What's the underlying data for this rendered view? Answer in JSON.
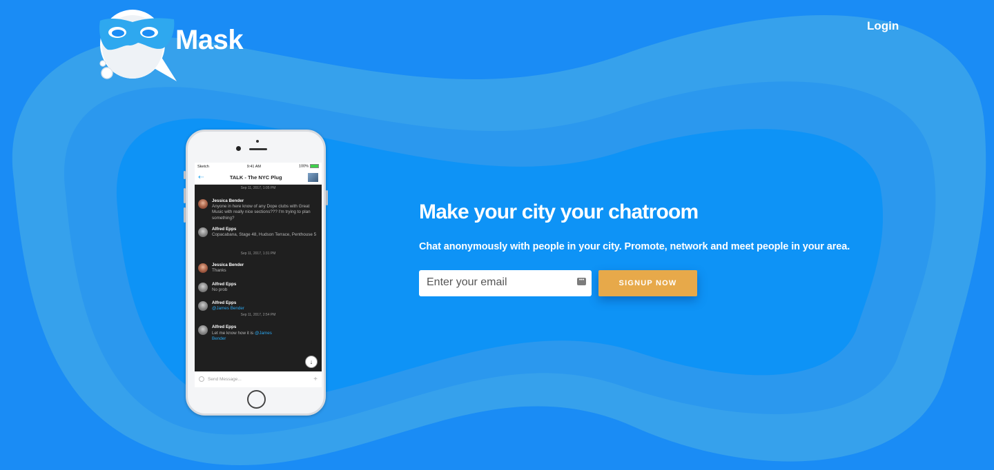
{
  "brand": {
    "name": "Mask"
  },
  "nav": {
    "login_label": "Login"
  },
  "colors": {
    "background": "#1a8cf5",
    "button": "#e7a94a",
    "accent": "#2aa7f0"
  },
  "hero": {
    "headline": "Make your city your chatroom",
    "subtext": "Chat anonymously with people in your city. Promote, network and meet people in your area.",
    "email_placeholder": "Enter your email",
    "signup_label": "SIGNUP NOW"
  },
  "phone": {
    "status": {
      "carrier": "Sketch",
      "time": "9:41 AM",
      "battery": "100%"
    },
    "chat_title": "TALK - The NYC Plug",
    "send_placeholder": "Send Message...",
    "dates": [
      "Sep 11, 2017, 1:05 PM",
      "Sep 11, 2017, 1:31 PM",
      "Sep 11, 2017, 2:54 PM"
    ],
    "messages": [
      {
        "name": "Jessica Bender",
        "text": "Anyone in  here know of any Dope clubs with Great Music with really nice sections??? I'm trying to plan something?"
      },
      {
        "name": "Alfred Epps",
        "text": "Copacabana, Stage 48, Hudson Terrace, Penthouse 5"
      },
      {
        "name": "Jessica Bender",
        "text": "Thanks"
      },
      {
        "name": "Alfred Epps",
        "text": "No prob"
      },
      {
        "name": "Alfred Epps",
        "mention": "@James Bender"
      },
      {
        "name": "Alfred Epps",
        "text": "Let me know how it is ",
        "mention": "@James Bender"
      }
    ]
  }
}
